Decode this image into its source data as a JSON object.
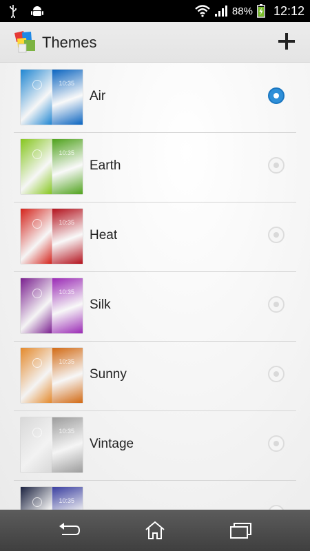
{
  "status_bar": {
    "battery_percent": "88%",
    "time": "12:12",
    "icons": [
      "usb-icon",
      "android-debug-icon",
      "wifi-icon",
      "signal-icon",
      "battery-charging-icon"
    ]
  },
  "action_bar": {
    "title": "Themes",
    "app_icon": "themes-app-icon",
    "add_icon": "plus-icon"
  },
  "themes": [
    {
      "name": "Air",
      "selected": true,
      "thumb_time": "10:35",
      "colors": [
        "#1f86d2",
        "#0a64c0"
      ]
    },
    {
      "name": "Earth",
      "selected": false,
      "thumb_time": "10:35",
      "colors": [
        "#86c61e",
        "#4fa21c"
      ]
    },
    {
      "name": "Heat",
      "selected": false,
      "thumb_time": "10:35",
      "colors": [
        "#d4231b",
        "#b3121d"
      ]
    },
    {
      "name": "Silk",
      "selected": false,
      "thumb_time": "10:35",
      "colors": [
        "#7a1f8f",
        "#9a2ab5"
      ]
    },
    {
      "name": "Sunny",
      "selected": false,
      "thumb_time": "10:35",
      "colors": [
        "#e4892b",
        "#d26a14"
      ]
    },
    {
      "name": "Vintage",
      "selected": false,
      "thumb_time": "10:35",
      "colors": [
        "#d8d8d8",
        "#9c9c9c"
      ]
    },
    {
      "name": "",
      "selected": false,
      "thumb_time": "10:35",
      "colors": [
        "#1b2240",
        "#3a3fa0"
      ]
    }
  ],
  "nav_bar": {
    "icons": [
      "back-icon",
      "home-icon",
      "recent-apps-icon"
    ]
  }
}
